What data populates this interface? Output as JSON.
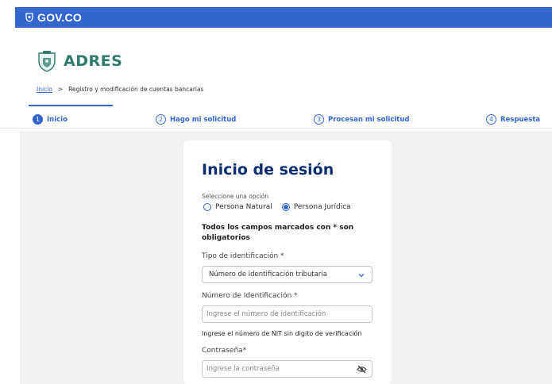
{
  "header": {
    "gov_label": "GOV.CO"
  },
  "brand": {
    "name": "ADRES"
  },
  "breadcrumb": {
    "home": "Inicio",
    "separator": ">",
    "current": "Registro y modificación de cuentas bancarias"
  },
  "stepper": {
    "steps": [
      {
        "num": "1",
        "label": "Inicio",
        "active": true
      },
      {
        "num": "2",
        "label": "Hago mi solicitud",
        "active": false
      },
      {
        "num": "3",
        "label": "Procesan mi solicitud",
        "active": false
      },
      {
        "num": "4",
        "label": "Respuesta",
        "active": false
      }
    ]
  },
  "login": {
    "title": "Inicio de sesión",
    "option_label": "Seleccione una opción",
    "radio_natural": "Persona Natural",
    "radio_juridica": "Persona Jurídica",
    "selected_option": "Persona Jurídica",
    "required_note": "Todos los campos marcados con * son obligatorios",
    "id_type_label": "Tipo de identificación *",
    "id_type_value": "Número de identificación tributaria",
    "id_number_label": "Número de Identificación *",
    "id_number_placeholder": "Ingrese el número de identificación",
    "id_help": "Ingrese el número de NIT sin digito de verificación",
    "password_label": "Contraseña*",
    "password_placeholder": "Ingrese la contraseña"
  },
  "colors": {
    "gov_blue": "#3366CC",
    "brand_green": "#2F7B6F",
    "title_navy": "#0B2F6E",
    "background_gray": "#F2F2F2"
  },
  "icons": {
    "gov": "colombia-shield-icon",
    "brand": "adres-shield-icon",
    "select": "chevron-down-icon",
    "password": "eye-slash-icon"
  }
}
